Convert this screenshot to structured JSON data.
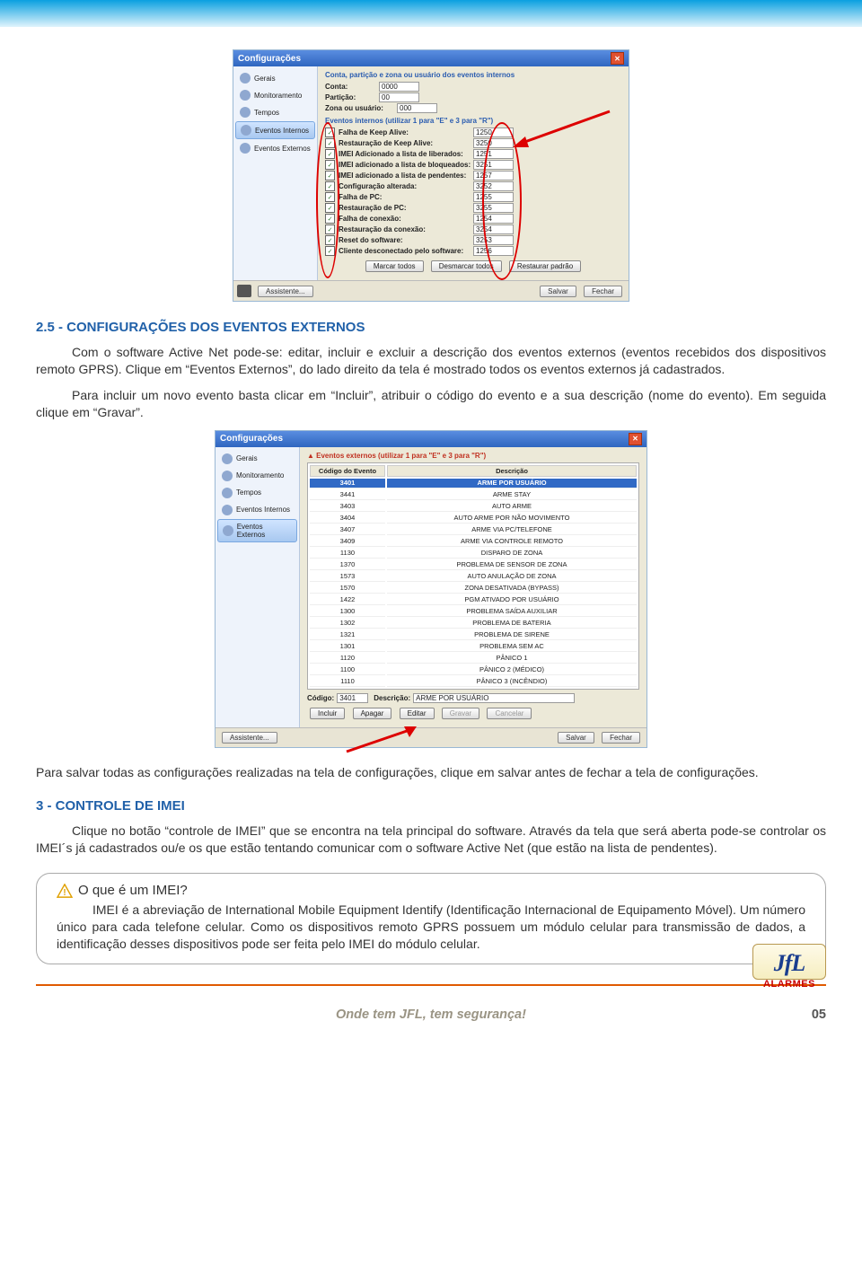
{
  "header": {},
  "screenshot1": {
    "title": "Configurações",
    "sidebar": [
      "Gerais",
      "Monitoramento",
      "Tempos",
      "Eventos Internos",
      "Eventos Externos"
    ],
    "topbar_label": "Conta, partição e zona ou usuário dos eventos internos",
    "fields": {
      "conta_l": "Conta:",
      "conta_v": "0000",
      "part_l": "Partição:",
      "part_v": "00",
      "zona_l": "Zona ou usuário:",
      "zona_v": "000"
    },
    "list_header": "Eventos internos (utilizar 1 para \"E\" e 3 para \"R\")",
    "rows": [
      {
        "l": "Falha de Keep Alive:",
        "v": "1250"
      },
      {
        "l": "Restauração de Keep Alive:",
        "v": "3250"
      },
      {
        "l": "IMEI Adicionado a lista de liberados:",
        "v": "1251"
      },
      {
        "l": "IMEI adicionado a lista de bloqueados:",
        "v": "3251"
      },
      {
        "l": "IMEI adicionado a lista de pendentes:",
        "v": "1257"
      },
      {
        "l": "Configuração alterada:",
        "v": "3252"
      },
      {
        "l": "Falha de PC:",
        "v": "1255"
      },
      {
        "l": "Restauração de PC:",
        "v": "3255"
      },
      {
        "l": "Falha de conexão:",
        "v": "1254"
      },
      {
        "l": "Restauração da conexão:",
        "v": "3254"
      },
      {
        "l": "Reset do software:",
        "v": "3253"
      },
      {
        "l": "Cliente desconectado pelo software:",
        "v": "1256"
      }
    ],
    "row_btns": [
      "Marcar todos",
      "Desmarcar todos",
      "Restaurar padrão"
    ],
    "bottom": {
      "assist": "Assistente...",
      "save": "Salvar",
      "close": "Fechar"
    }
  },
  "section1": {
    "title": "2.5 - CONFIGURAÇÕES DOS EVENTOS EXTERNOS",
    "p1": "Com o software Active Net pode-se: editar, incluir e excluir a descrição dos eventos externos (eventos recebidos dos dispositivos remoto GPRS). Clique em “Eventos Externos”, do lado direito da tela é mostrado todos os eventos externos já cadastrados.",
    "p2": "Para incluir um novo evento basta clicar em “Incluir”, atribuir o código do evento e a sua descrição (nome do evento). Em seguida clique em “Gravar”."
  },
  "screenshot2": {
    "title": "Configurações",
    "sidebar": [
      "Gerais",
      "Monitoramento",
      "Tempos",
      "Eventos Internos",
      "Eventos Externos"
    ],
    "list_header": "Eventos externos (utilizar 1 para \"E\" e 3 para \"R\")",
    "table_hdr": {
      "c": "Código do Evento",
      "d": "Descrição"
    },
    "rows": [
      {
        "c": "3401",
        "d": "ARME POR USUÁRIO",
        "sel": true
      },
      {
        "c": "3441",
        "d": "ARME STAY"
      },
      {
        "c": "3403",
        "d": "AUTO ARME"
      },
      {
        "c": "3404",
        "d": "AUTO ARME POR NÃO MOVIMENTO"
      },
      {
        "c": "3407",
        "d": "ARME VIA PC/TELEFONE"
      },
      {
        "c": "3409",
        "d": "ARME VIA CONTROLE REMOTO"
      },
      {
        "c": "1130",
        "d": "DISPARO DE ZONA"
      },
      {
        "c": "1370",
        "d": "PROBLEMA DE SENSOR DE ZONA"
      },
      {
        "c": "1573",
        "d": "AUTO ANULAÇÃO DE ZONA"
      },
      {
        "c": "1570",
        "d": "ZONA DESATIVADA (BYPASS)"
      },
      {
        "c": "1422",
        "d": "PGM ATIVADO POR USUÁRIO"
      },
      {
        "c": "1300",
        "d": "PROBLEMA SAÍDA AUXILIAR"
      },
      {
        "c": "1302",
        "d": "PROBLEMA DE BATERIA"
      },
      {
        "c": "1321",
        "d": "PROBLEMA DE SIRENE"
      },
      {
        "c": "1301",
        "d": "PROBLEMA SEM AC"
      },
      {
        "c": "1120",
        "d": "PÂNICO 1"
      },
      {
        "c": "1100",
        "d": "PÂNICO 2 (MÉDICO)"
      },
      {
        "c": "1110",
        "d": "PÂNICO 3 (INCÊNDIO)"
      }
    ],
    "edit": {
      "cod_l": "Código:",
      "cod_v": "3401",
      "desc_l": "Descrição:",
      "desc_v": "ARME POR USUÁRIO"
    },
    "row_btns": [
      "Incluir",
      "Apagar",
      "Editar",
      "Gravar",
      "Cancelar"
    ],
    "bottom": {
      "assist": "Assistente...",
      "save": "Salvar",
      "close": "Fechar"
    }
  },
  "midtext": "Para salvar todas as configurações realizadas na tela de configurações, clique em salvar antes de fechar a tela de configurações.",
  "section2": {
    "title": "3 - CONTROLE DE IMEI",
    "p1": "Clique no botão “controle de IMEI” que se encontra na tela principal do software. Através da tela que será aberta pode-se controlar os IMEI´s já cadastrados ou/e os que estão tentando comunicar com o software Active Net (que estão na lista de pendentes)."
  },
  "callout": {
    "title": "O que é um IMEI?",
    "body": "IMEI é a abreviação de International Mobile Equipment Identify (Identificação Internacional de Equipamento Móvel). Um número único para cada telefone celular. Como os dispositivos remoto GPRS possuem um módulo celular para transmissão de dados, a identificação desses dispositivos pode ser feita pelo IMEI do módulo celular."
  },
  "logo": {
    "brand": "JfL",
    "sub": "ALARMES"
  },
  "footer": {
    "slogan": "Onde tem JFL, tem segurança!",
    "page": "05"
  }
}
